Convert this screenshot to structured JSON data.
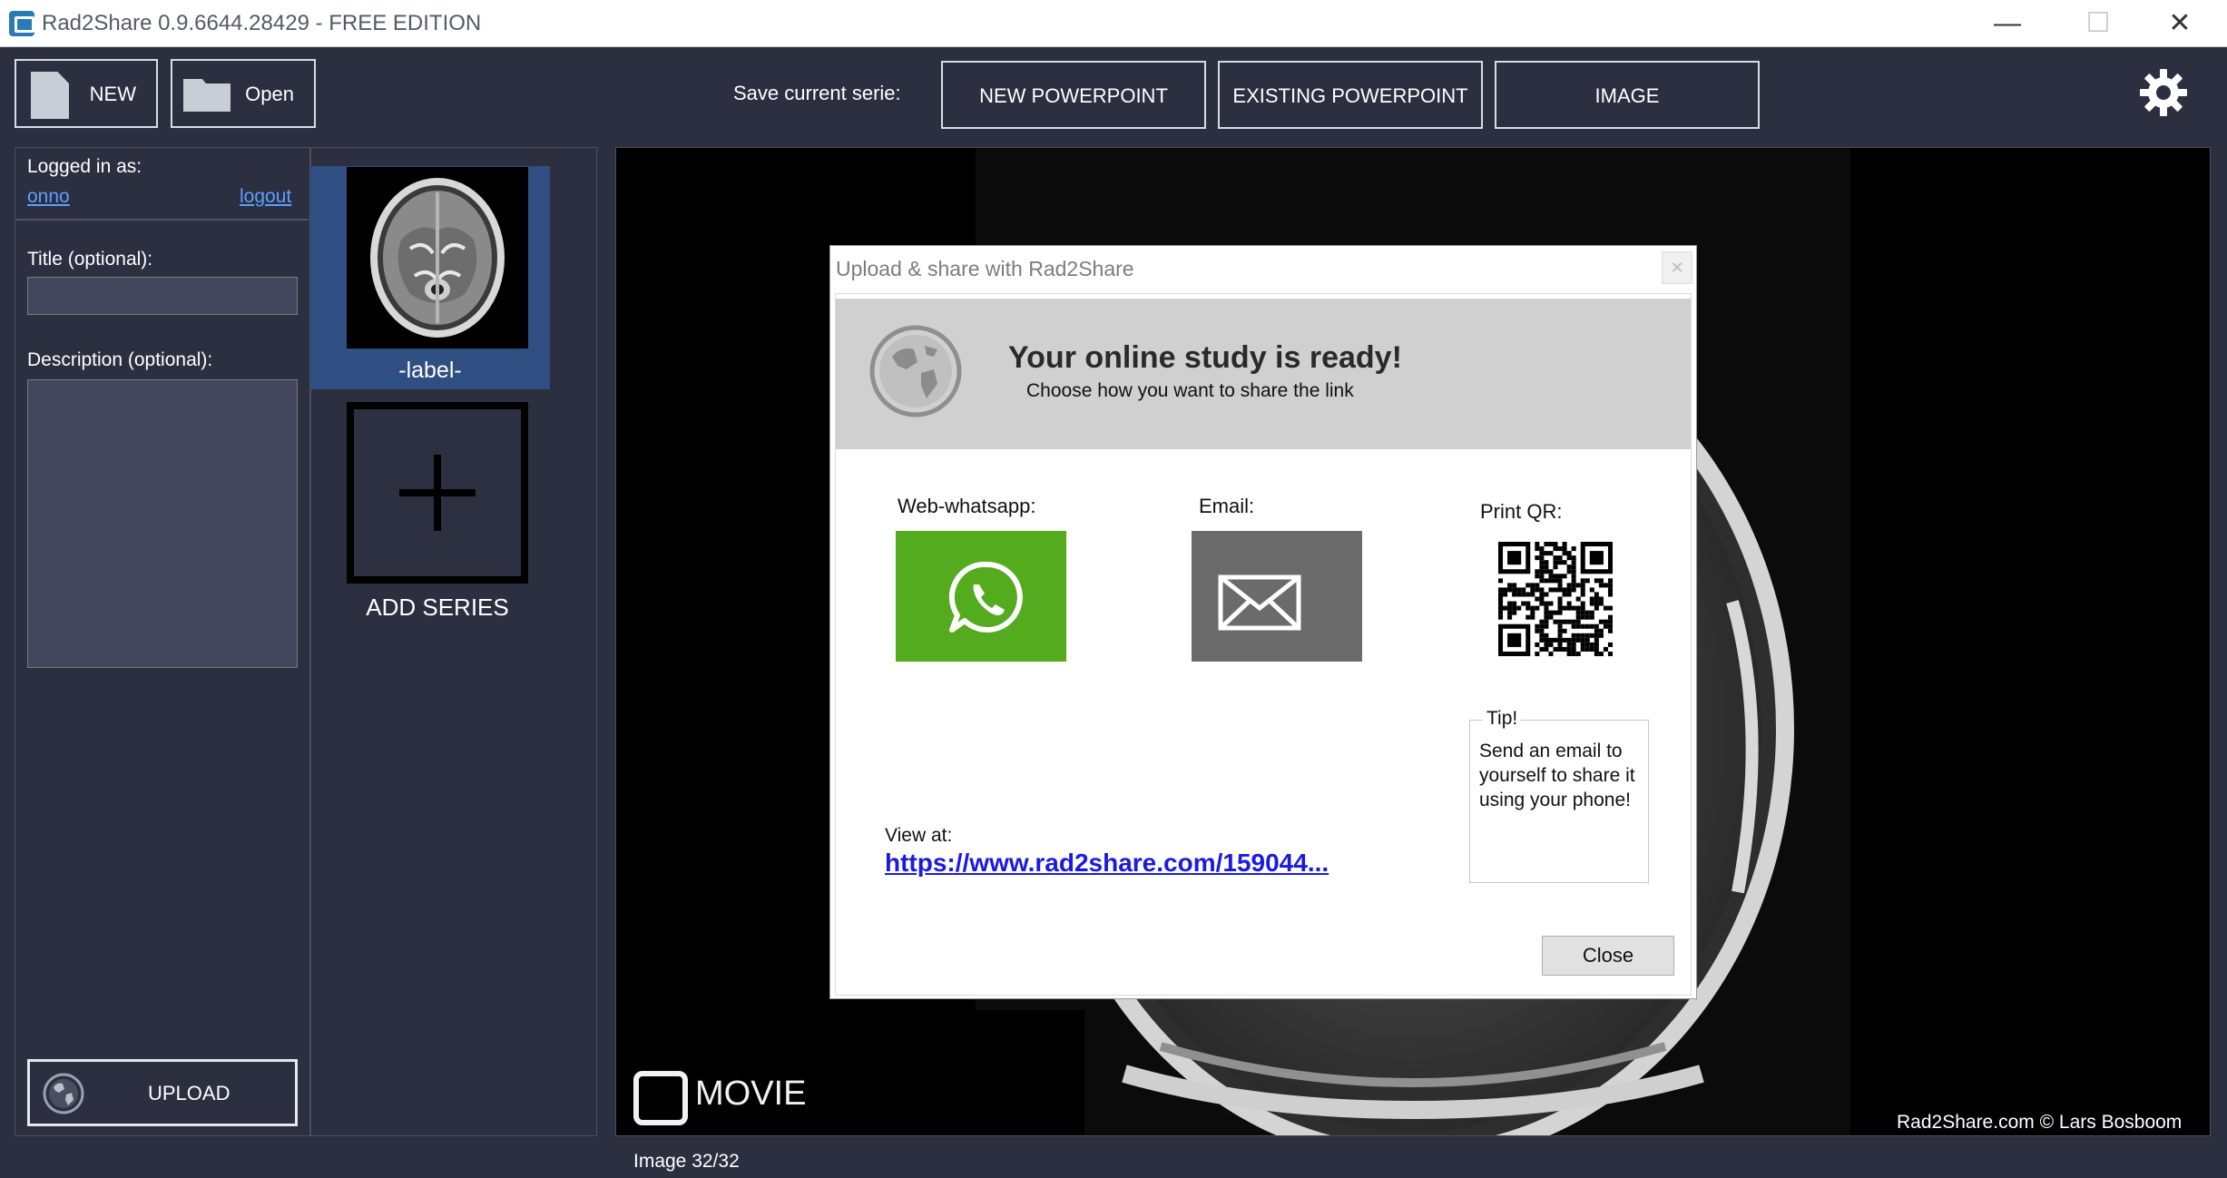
{
  "window": {
    "title": "Rad2Share 0.9.6644.28429 - FREE EDITION",
    "minimize": "—",
    "maximize": "☐",
    "close": "✕"
  },
  "toolbar": {
    "new_label": "NEW",
    "open_label": "Open",
    "save_serie_label": "Save current serie:",
    "new_powerpoint": "NEW POWERPOINT",
    "existing_powerpoint": "EXISTING POWERPOINT",
    "image": "IMAGE"
  },
  "left_panel": {
    "logged_in_label": "Logged in as:",
    "username": "onno",
    "logout": "logout",
    "title_label": "Title (optional):",
    "title_value": "",
    "description_label": "Description (optional):",
    "description_value": "",
    "upload_label": "UPLOAD"
  },
  "series": {
    "thumb_label": "-label-",
    "add_series_label": "ADD SERIES"
  },
  "viewer": {
    "movie_label": "MOVIE",
    "credit": "Rad2Share.com © Lars Bosboom",
    "image_counter": "Image 32/32"
  },
  "dialog": {
    "title": "Upload & share with Rad2Share",
    "close_x": "✕",
    "heading": "Your online study is ready!",
    "subheading": "Choose how you want to share the link",
    "whatsapp_label": "Web-whatsapp:",
    "email_label": "Email:",
    "qr_label": "Print QR:",
    "tip_title": "Tip!",
    "tip_text": "Send an email to yourself to share it using your phone!",
    "view_at_label": "View at:",
    "view_at_link": "https://www.rad2share.com/159044...",
    "close_button": "Close"
  },
  "colors": {
    "background": "#2b2f40",
    "selected_series": "#2f4e82",
    "link": "#5aa0ff",
    "whatsapp_green": "#54ab1d",
    "email_grey": "#6b6b6b",
    "dialog_header": "#d0d0d0",
    "url_blue": "#1a1ae0"
  },
  "icons": {
    "new": "document-icon",
    "open": "folder-icon",
    "settings": "gear-icon",
    "upload": "globe-icon",
    "whatsapp": "whatsapp-icon",
    "email": "envelope-icon",
    "movie": "movie-checkbox-icon"
  }
}
